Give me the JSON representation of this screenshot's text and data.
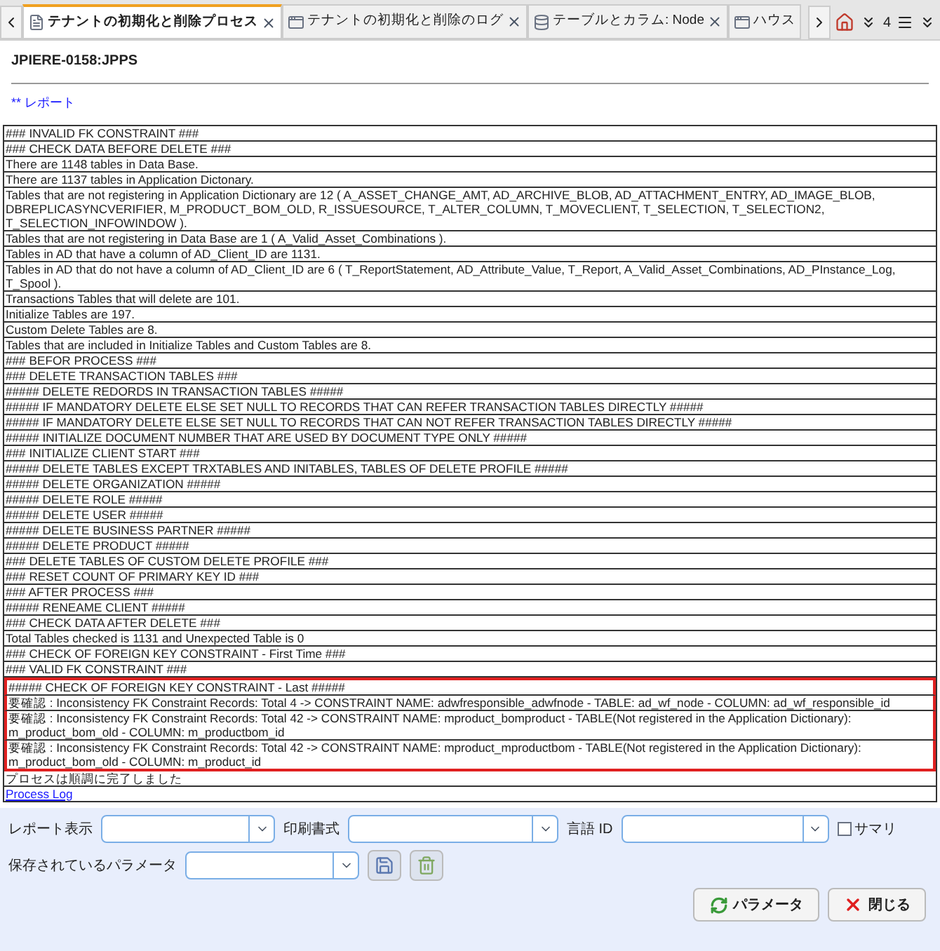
{
  "tabs": [
    {
      "label": "テナントの初期化と削除プロセス",
      "kind": "form",
      "selected": true
    },
    {
      "label": "テナントの初期化と削除のログ",
      "kind": "window",
      "selected": false
    },
    {
      "label": "テーブルとカラム: Node",
      "kind": "database",
      "selected": false
    },
    {
      "label": "ハウス",
      "kind": "window",
      "selected": false
    }
  ],
  "tab_count": "4",
  "process_title": "JPIERE-0158:JPPS",
  "report_link": "** レポート",
  "log_rows": [
    {
      "text": "### INVALID FK CONSTRAINT ###",
      "flagged": false
    },
    {
      "text": "### CHECK DATA BEFORE DELETE ###",
      "flagged": false
    },
    {
      "text": "There are 1148 tables in Data Base.",
      "flagged": false
    },
    {
      "text": "There are 1137 tables in Application Dictonary.",
      "flagged": false
    },
    {
      "text": "Tables that are not registering in Application Dictionary are 12 ( A_ASSET_CHANGE_AMT, AD_ARCHIVE_BLOB, AD_ATTACHMENT_ENTRY, AD_IMAGE_BLOB, DBREPLICASYNCVERIFIER, M_PRODUCT_BOM_OLD, R_ISSUESOURCE, T_ALTER_COLUMN, T_MOVECLIENT, T_SELECTION, T_SELECTION2, T_SELECTION_INFOWINDOW ).",
      "flagged": false
    },
    {
      "text": "Tables that are not registering in Data Base are 1 ( A_Valid_Asset_Combinations ).",
      "flagged": false
    },
    {
      "text": "Tables in AD that have a column of AD_Client_ID are 1131.",
      "flagged": false
    },
    {
      "text": "Tables in AD that do not have a column of AD_Client_ID are 6 ( T_ReportStatement, AD_Attribute_Value, T_Report, A_Valid_Asset_Combinations, AD_PInstance_Log, T_Spool ).",
      "flagged": false
    },
    {
      "text": "Transactions Tables that will delete are 101.",
      "flagged": false
    },
    {
      "text": "Initialize Tables are 197.",
      "flagged": false
    },
    {
      "text": "Custom Delete Tables are 8.",
      "flagged": false
    },
    {
      "text": "Tables that are included in Initialize Tables and Custom Tables are 8.",
      "flagged": false
    },
    {
      "text": "### BEFOR PROCESS ###",
      "flagged": false
    },
    {
      "text": "### DELETE TRANSACTION TABLES ###",
      "flagged": false
    },
    {
      "text": "##### DELETE REDORDS IN TRANSACTION TABLES #####",
      "flagged": false
    },
    {
      "text": "##### IF MANDATORY DELETE ELSE SET NULL TO RECORDS THAT CAN REFER TRANSACTION TABLES DIRECTLY #####",
      "flagged": false
    },
    {
      "text": "##### IF MANDATORY DELETE ELSE SET NULL TO RECORDS THAT CAN NOT REFER TRANSACTION TABLES DIRECTLY #####",
      "flagged": false
    },
    {
      "text": "##### INITIALIZE DOCUMENT NUMBER THAT ARE USED BY DOCUMENT TYPE ONLY #####",
      "flagged": false
    },
    {
      "text": "### INITIALIZE CLIENT START ###",
      "flagged": false
    },
    {
      "text": "##### DELETE TABLES EXCEPT TRXTABLES AND INITABLES, TABLES OF DELETE PROFILE #####",
      "flagged": false
    },
    {
      "text": "##### DELETE ORGANIZATION #####",
      "flagged": false
    },
    {
      "text": "##### DELETE ROLE #####",
      "flagged": false
    },
    {
      "text": "##### DELETE USER #####",
      "flagged": false
    },
    {
      "text": "##### DELETE BUSINESS PARTNER #####",
      "flagged": false
    },
    {
      "text": "##### DELETE PRODUCT #####",
      "flagged": false
    },
    {
      "text": "### DELETE TABLES OF CUSTOM DELETE PROFILE ###",
      "flagged": false
    },
    {
      "text": "### RESET COUNT OF PRIMARY KEY ID ###",
      "flagged": false
    },
    {
      "text": "### AFTER PROCESS ###",
      "flagged": false
    },
    {
      "text": "##### RENEAME CLIENT #####",
      "flagged": false
    },
    {
      "text": "### CHECK DATA AFTER DELETE ###",
      "flagged": false
    },
    {
      "text": "Total Tables checked is 1131 and Unexpected Table is 0",
      "flagged": false
    },
    {
      "text": "### CHECK OF FOREIGN KEY CONSTRAINT - First Time ###",
      "flagged": false
    },
    {
      "text": "### VALID FK CONSTRAINT ###",
      "flagged": false
    },
    {
      "text": "##### CHECK OF FOREIGN KEY CONSTRAINT - Last #####",
      "flagged": true
    },
    {
      "text": "要確認 : Inconsistency FK Constraint Records: Total 4 -> CONSTRAINT NAME: adwfresponsible_adwfnode - TABLE: ad_wf_node - COLUMN: ad_wf_responsible_id",
      "flagged": true
    },
    {
      "text": "要確認 : Inconsistency FK Constraint Records: Total 42 -> CONSTRAINT NAME: mproduct_bomproduct - TABLE(Not registered in the Application Dictionary): m_product_bom_old - COLUMN: m_productbom_id",
      "flagged": true
    },
    {
      "text": "要確認 : Inconsistency FK Constraint Records: Total 42 -> CONSTRAINT NAME: mproduct_mproductbom - TABLE(Not registered in the Application Dictionary): m_product_bom_old - COLUMN: m_product_id",
      "flagged": true
    },
    {
      "text": "プロセスは順調に完了しました",
      "flagged": false
    }
  ],
  "process_log_link": "Process Log",
  "parameters": {
    "report_view_label": "レポート表示",
    "print_format_label": "印刷書式",
    "language_label": "言語 ID",
    "summary": {
      "label": "サマリ",
      "checked": false
    },
    "saved_parameters_label": "保存されているパラメータ"
  },
  "buttons": [
    {
      "label": "パラメータ",
      "kind": "parameters"
    },
    {
      "label": "閉じる",
      "kind": "close"
    }
  ]
}
